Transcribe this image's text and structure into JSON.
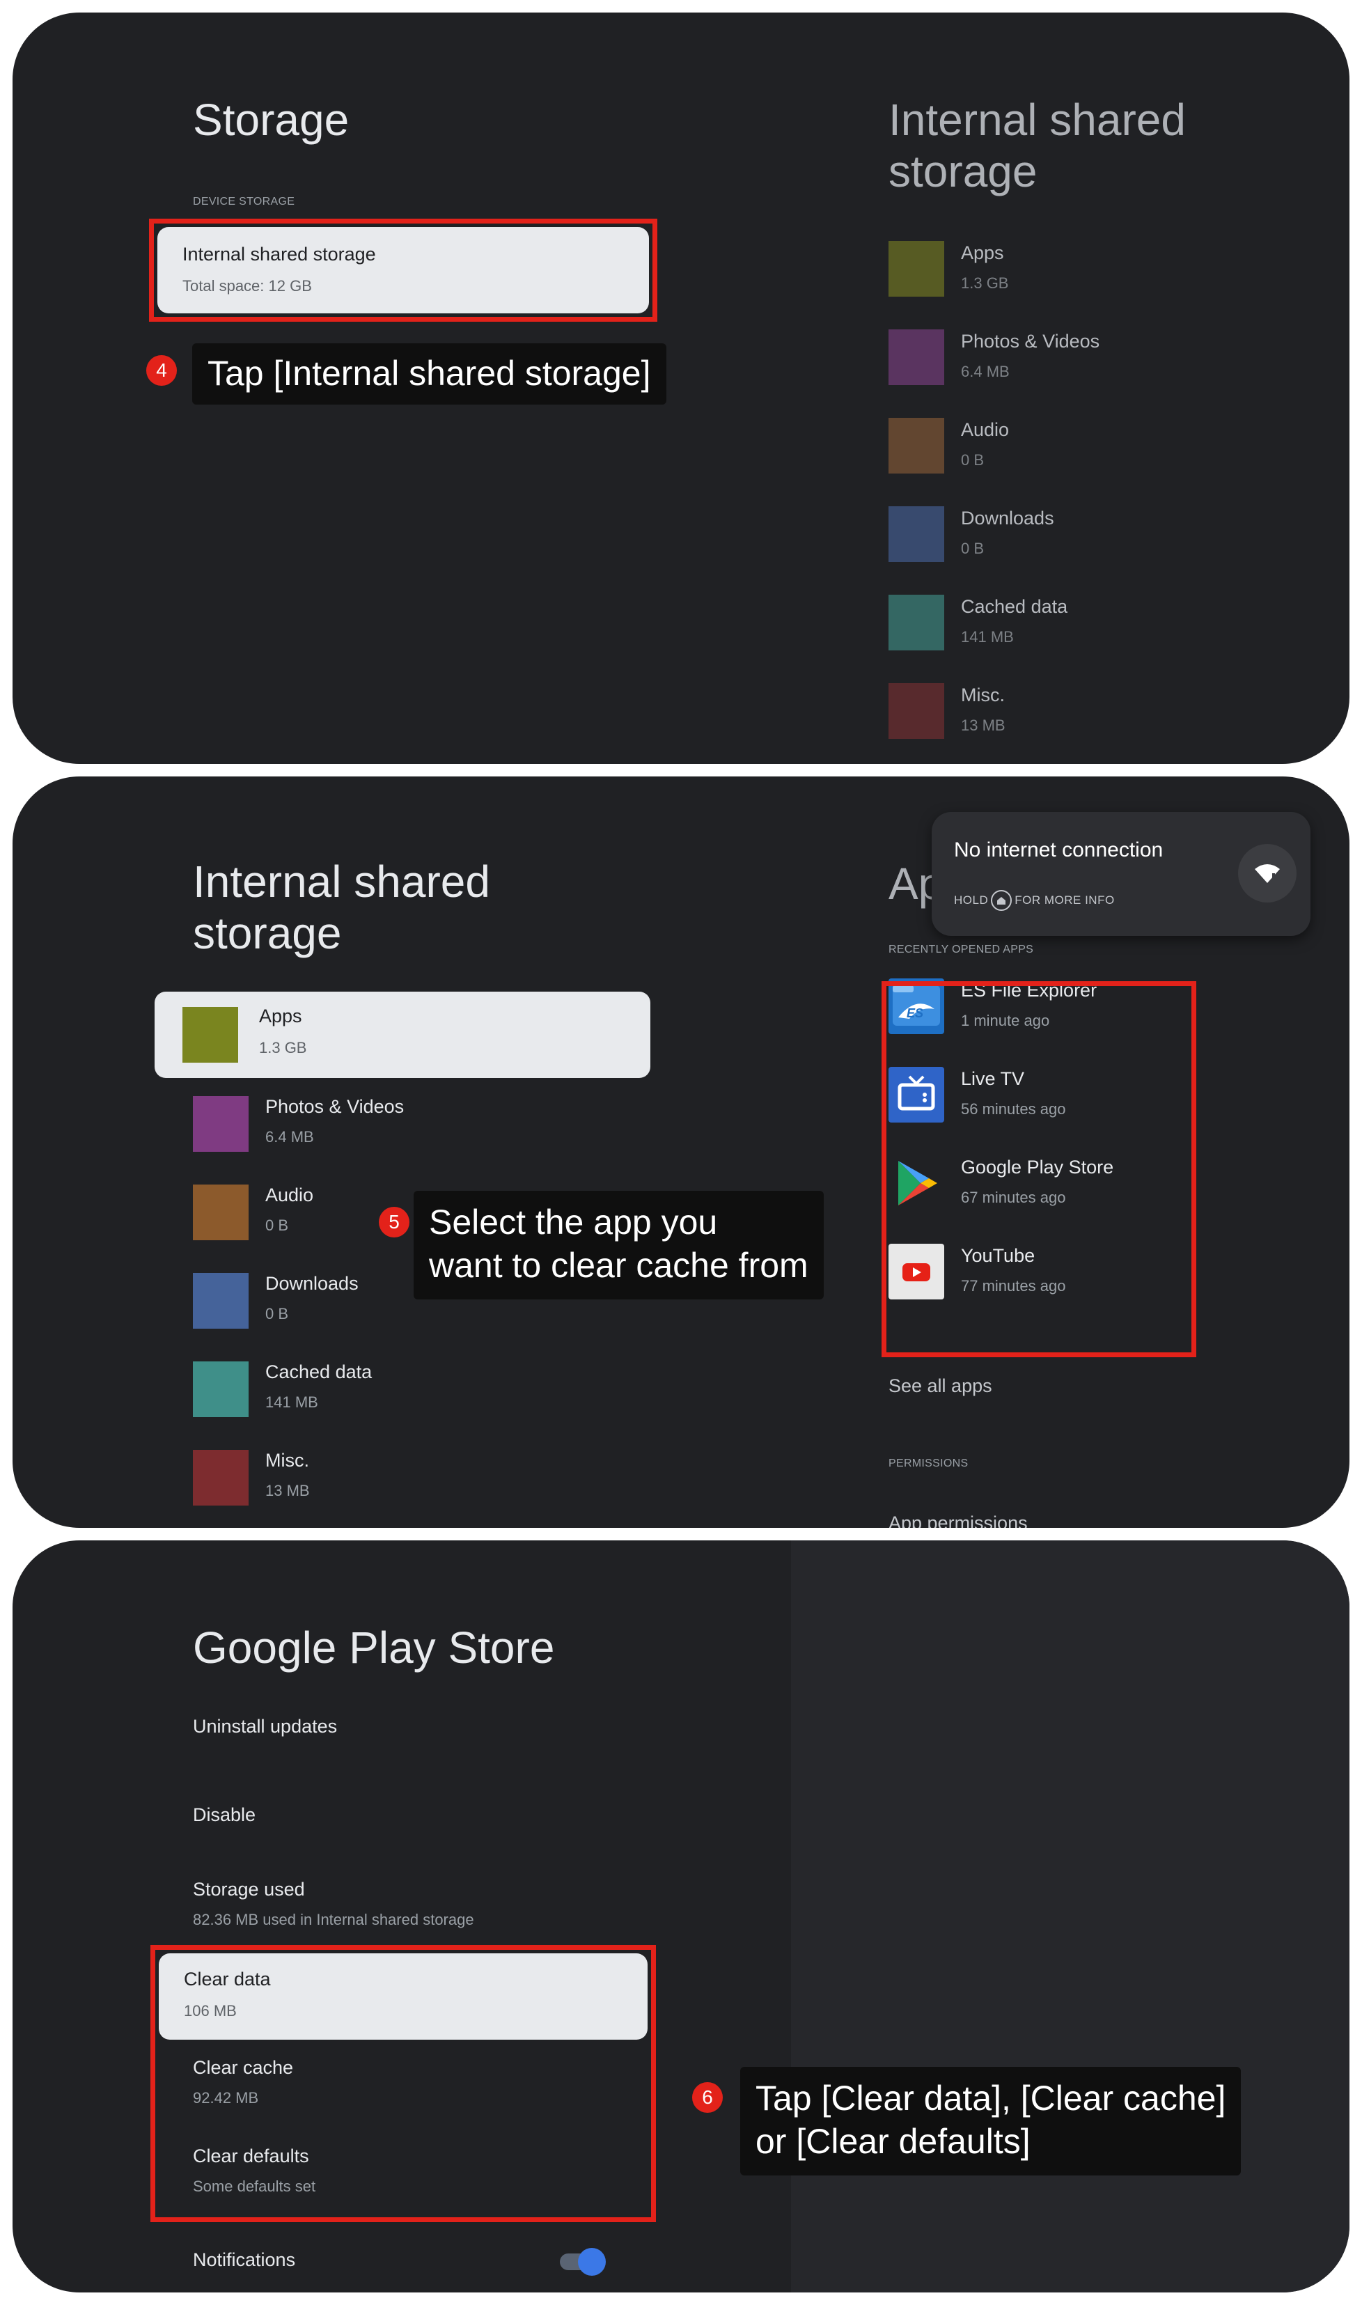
{
  "colors": {
    "panel_bg": "#202124",
    "card_bg": "#e8eaed",
    "highlight_red": "#e3221a",
    "apps": "#7a851f",
    "photos_videos": "#7f3b82",
    "audio": "#8c5a2c",
    "downloads": "#45639a",
    "cached_data": "#3f8f89",
    "misc": "#7d2c2f",
    "toggle_on": "#3b78e7"
  },
  "step4": {
    "page_title": "Storage",
    "section_label": "DEVICE STORAGE",
    "selected_item": {
      "title": "Internal shared storage",
      "subtitle": "Total space: 12 GB"
    },
    "badge": "4",
    "callout": "Tap [Internal shared storage]",
    "preview": {
      "title_line1": "Internal shared",
      "title_line2": "storage",
      "items": [
        {
          "label": "Apps",
          "value": "1.3 GB",
          "color_key": "apps"
        },
        {
          "label": "Photos & Videos",
          "value": "6.4 MB",
          "color_key": "photos_videos"
        },
        {
          "label": "Audio",
          "value": "0 B",
          "color_key": "audio"
        },
        {
          "label": "Downloads",
          "value": "0 B",
          "color_key": "downloads"
        },
        {
          "label": "Cached data",
          "value": "141 MB",
          "color_key": "cached_data"
        },
        {
          "label": "Misc.",
          "value": "13 MB",
          "color_key": "misc"
        }
      ]
    }
  },
  "step5": {
    "page_title_line1": "Internal shared",
    "page_title_line2": "storage",
    "items": [
      {
        "label": "Apps",
        "value": "1.3 GB"
      },
      {
        "label": "Photos & Videos",
        "value": "6.4 MB"
      },
      {
        "label": "Audio",
        "value": "0 B"
      },
      {
        "label": "Downloads",
        "value": "0 B"
      },
      {
        "label": "Cached data",
        "value": "141 MB"
      },
      {
        "label": "Misc.",
        "value": "13 MB"
      }
    ],
    "badge": "5",
    "callout_line1": "Select the app you",
    "callout_line2": "want to clear cache from",
    "right_title_partial": "Ap",
    "toast": {
      "title": "No internet connection",
      "hint_prefix": "HOLD",
      "hint_suffix": "FOR MORE INFO",
      "home_icon": "home-icon",
      "wifi_icon": "wifi-warning-icon"
    },
    "recent_section_label": "RECENTLY OPENED APPS",
    "recent_apps": [
      {
        "name": "ES File Explorer",
        "time": "1 minute ago",
        "icon": "es-file-explorer-icon"
      },
      {
        "name": "Live TV",
        "time": "56 minutes ago",
        "icon": "live-tv-icon"
      },
      {
        "name": "Google Play Store",
        "time": "67 minutes ago",
        "icon": "google-play-store-icon"
      },
      {
        "name": "YouTube",
        "time": "77 minutes ago",
        "icon": "youtube-icon"
      }
    ],
    "see_all": "See all apps",
    "permissions_label": "PERMISSIONS",
    "app_permissions": "App permissions"
  },
  "step6": {
    "page_title": "Google Play Store",
    "uninstall_updates": "Uninstall updates",
    "disable": "Disable",
    "storage_used_title": "Storage used",
    "storage_used_sub": "82.36 MB used in Internal shared storage",
    "clear_data_title": "Clear data",
    "clear_data_sub": "106 MB",
    "clear_cache_title": "Clear cache",
    "clear_cache_sub": "92.42 MB",
    "clear_defaults_title": "Clear defaults",
    "clear_defaults_sub": "Some defaults set",
    "notifications": "Notifications",
    "notifications_on": true,
    "badge": "6",
    "callout_line1": "Tap [Clear data], [Clear cache]",
    "callout_line2": "or [Clear defaults]"
  }
}
